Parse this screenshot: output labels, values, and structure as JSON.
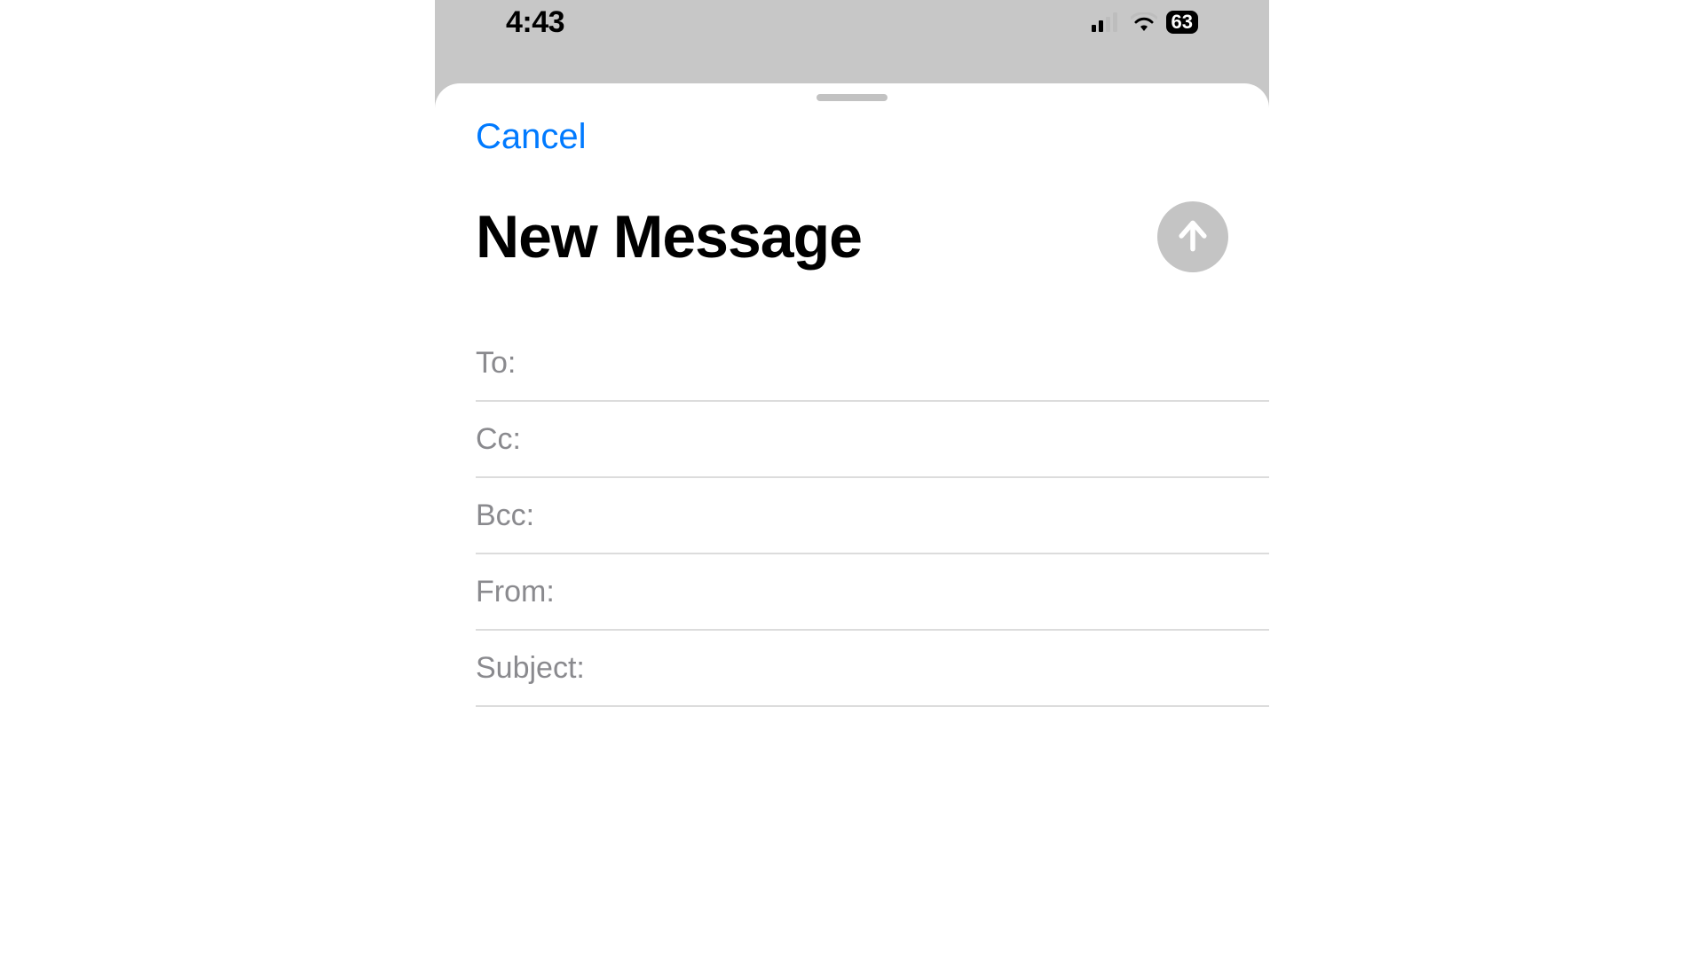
{
  "status": {
    "time": "4:43",
    "battery": "63"
  },
  "sheet": {
    "cancel_label": "Cancel",
    "title": "New Message"
  },
  "fields": {
    "to": {
      "label": "To:",
      "value": ""
    },
    "cc": {
      "label": "Cc:",
      "value": ""
    },
    "bcc": {
      "label": "Bcc:",
      "value": ""
    },
    "from": {
      "label": "From:",
      "value": ""
    },
    "subject": {
      "label": "Subject:",
      "value": ""
    }
  }
}
